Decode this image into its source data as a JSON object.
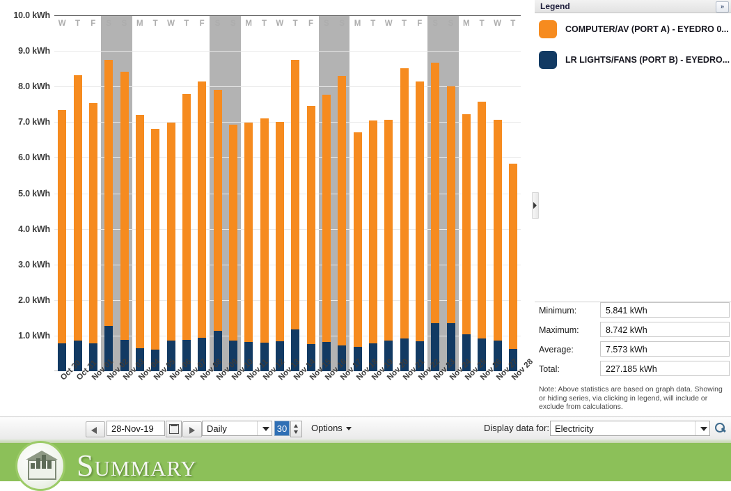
{
  "legend": {
    "title": "Legend",
    "expand_icon": "»",
    "items": [
      {
        "label": "COMPUTER/AV (PORT A) - EYEDRO 0...",
        "color": "#f68b1f"
      },
      {
        "label": "LR LIGHTS/FANS (PORT B) - EYEDRO...",
        "color": "#123a63"
      }
    ]
  },
  "stats": {
    "rows": [
      {
        "label": "Minimum:",
        "value": "5.841 kWh"
      },
      {
        "label": "Maximum:",
        "value": "8.742 kWh"
      },
      {
        "label": "Average:",
        "value": "7.573 kWh"
      },
      {
        "label": "Total:",
        "value": "227.185 kWh"
      }
    ],
    "note": "Note: Above statistics are based on graph data. Showing or hiding series, via clicking in legend, will include or exclude from calculations."
  },
  "toolbar": {
    "date_value": "28-Nov-19",
    "interval_value": "Daily",
    "count_value": "30",
    "options_label": "Options",
    "display_label": "Display data for:",
    "display_value": "Electricity",
    "prev_icon": "arrow-left-icon",
    "next_icon": "arrow-right-icon",
    "calendar_icon": "calendar-icon",
    "search_icon": "magnifier-icon"
  },
  "footer": {
    "title": "Summary",
    "accent": "#8cc059"
  },
  "chart_data": {
    "type": "bar",
    "stacked": true,
    "title": "",
    "xlabel": "",
    "ylabel": "kWh",
    "ylim": [
      0,
      10
    ],
    "ytick_labels": [
      "10.0 kWh",
      "9.0 kWh",
      "8.0 kWh",
      "7.0 kWh",
      "6.0 kWh",
      "5.0 kWh",
      "4.0 kWh",
      "3.0 kWh",
      "2.0 kWh",
      "1.0 kWh"
    ],
    "ytick_values": [
      10,
      9,
      8,
      7,
      6,
      5,
      4,
      3,
      2,
      1
    ],
    "grid": true,
    "legend_position": "right",
    "categories": [
      "Oct 30",
      "Oct 31",
      "Nov 01",
      "Nov 02",
      "Nov 03",
      "Nov 04",
      "Nov 05",
      "Nov 06",
      "Nov 07",
      "Nov 08",
      "Nov 09",
      "Nov 10",
      "Nov 11",
      "Nov 12",
      "Nov 13",
      "Nov 14",
      "Nov 15",
      "Nov 16",
      "Nov 17",
      "Nov 18",
      "Nov 19",
      "Nov 20",
      "Nov 21",
      "Nov 22",
      "Nov 23",
      "Nov 24",
      "Nov 25",
      "Nov 26",
      "Nov 27",
      "Nov 28"
    ],
    "day_letters": [
      "W",
      "T",
      "F",
      "S",
      "S",
      "M",
      "T",
      "W",
      "T",
      "F",
      "S",
      "S",
      "M",
      "T",
      "W",
      "T",
      "F",
      "S",
      "S",
      "M",
      "T",
      "W",
      "T",
      "F",
      "S",
      "S",
      "M",
      "T",
      "W",
      "T"
    ],
    "weekend_indices": [
      3,
      4,
      10,
      11,
      17,
      18,
      24,
      25
    ],
    "series": [
      {
        "name": "LR LIGHTS/FANS (PORT B) - EYEDRO...",
        "color": "#123a63",
        "values": [
          0.78,
          0.86,
          0.78,
          1.27,
          0.88,
          0.64,
          0.6,
          0.86,
          0.89,
          0.94,
          1.13,
          0.86,
          0.82,
          0.8,
          0.85,
          1.18,
          0.76,
          0.83,
          0.73,
          0.68,
          0.79,
          0.87,
          0.92,
          0.84,
          1.35,
          1.35,
          1.04,
          0.92,
          0.86,
          0.62
        ]
      },
      {
        "name": "COMPUTER/AV (PORT A) - EYEDRO 0...",
        "color": "#f68b1f",
        "values": [
          6.55,
          7.46,
          6.76,
          7.47,
          7.53,
          6.57,
          6.22,
          6.13,
          6.89,
          7.2,
          6.77,
          6.07,
          6.16,
          6.31,
          6.16,
          7.56,
          6.69,
          6.94,
          7.57,
          6.03,
          6.25,
          6.19,
          7.59,
          7.31,
          7.31,
          6.66,
          6.18,
          6.66,
          6.21,
          5.22
        ]
      }
    ],
    "totals": [
      7.33,
      8.32,
      7.54,
      8.74,
      8.41,
      7.21,
      6.82,
      6.99,
      7.78,
      8.14,
      7.9,
      6.93,
      6.98,
      7.11,
      7.01,
      8.74,
      7.45,
      7.77,
      8.3,
      6.71,
      7.04,
      7.06,
      8.51,
      8.15,
      8.66,
      8.01,
      7.22,
      7.58,
      7.07,
      5.84
    ]
  }
}
